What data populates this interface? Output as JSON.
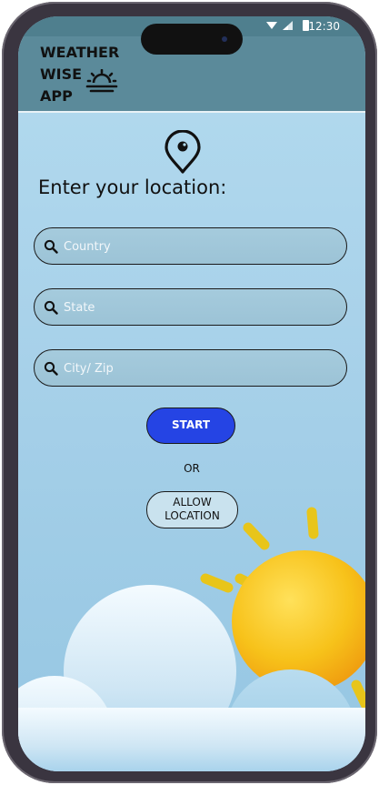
{
  "status_bar": {
    "time": "12:30"
  },
  "header": {
    "title_lines": [
      "WEATHER",
      "WISE",
      "APP"
    ],
    "logo_icon": "sunrise-icon"
  },
  "location_prompt": "Enter your location:",
  "fields": {
    "country": {
      "placeholder": "Country",
      "value": ""
    },
    "state": {
      "placeholder": "State",
      "value": ""
    },
    "city": {
      "placeholder": "City/ Zip",
      "value": ""
    }
  },
  "start_label": "START",
  "or_label": "OR",
  "allow_location_lines": [
    "ALLOW",
    "LOCATION"
  ],
  "colors": {
    "header": "#5b8a9a",
    "start_button": "#2544e4",
    "background": "#b3dbef",
    "sun": "#f7c21a"
  }
}
